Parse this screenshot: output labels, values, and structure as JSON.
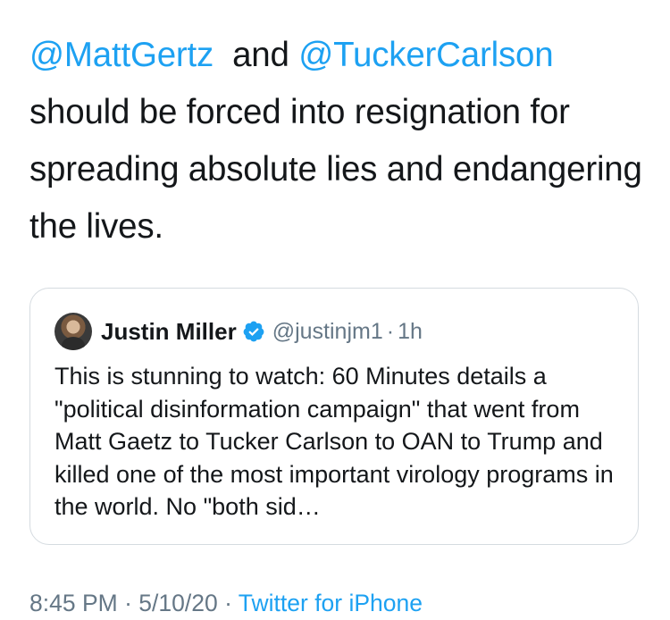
{
  "tweet": {
    "mention_1": "@MattGertz",
    "connector": "and",
    "mention_2": "@TuckerCarlson",
    "text": "should be forced into resignation for spreading absolute lies and endangering the lives."
  },
  "quoted_tweet": {
    "avatar_icon": "user-avatar",
    "name": "Justin Miller",
    "verified_icon": "verified-badge-icon",
    "handle": "@justinjm1",
    "separator": "·",
    "time": "1h",
    "text": "This is stunning to watch: 60 Minutes details a \"political disinformation campaign\" that went from Matt Gaetz to Tucker Carlson to OAN to Trump and killed one of the most important virology programs in the world. No \"both sid…"
  },
  "meta": {
    "time": "8:45 PM",
    "separator_1": "·",
    "date": "5/10/20",
    "separator_2": "·",
    "source": "Twitter for iPhone"
  },
  "colors": {
    "link": "#1da1f2",
    "text": "#14171a",
    "secondary": "#657786",
    "border": "#d5dbe0"
  }
}
